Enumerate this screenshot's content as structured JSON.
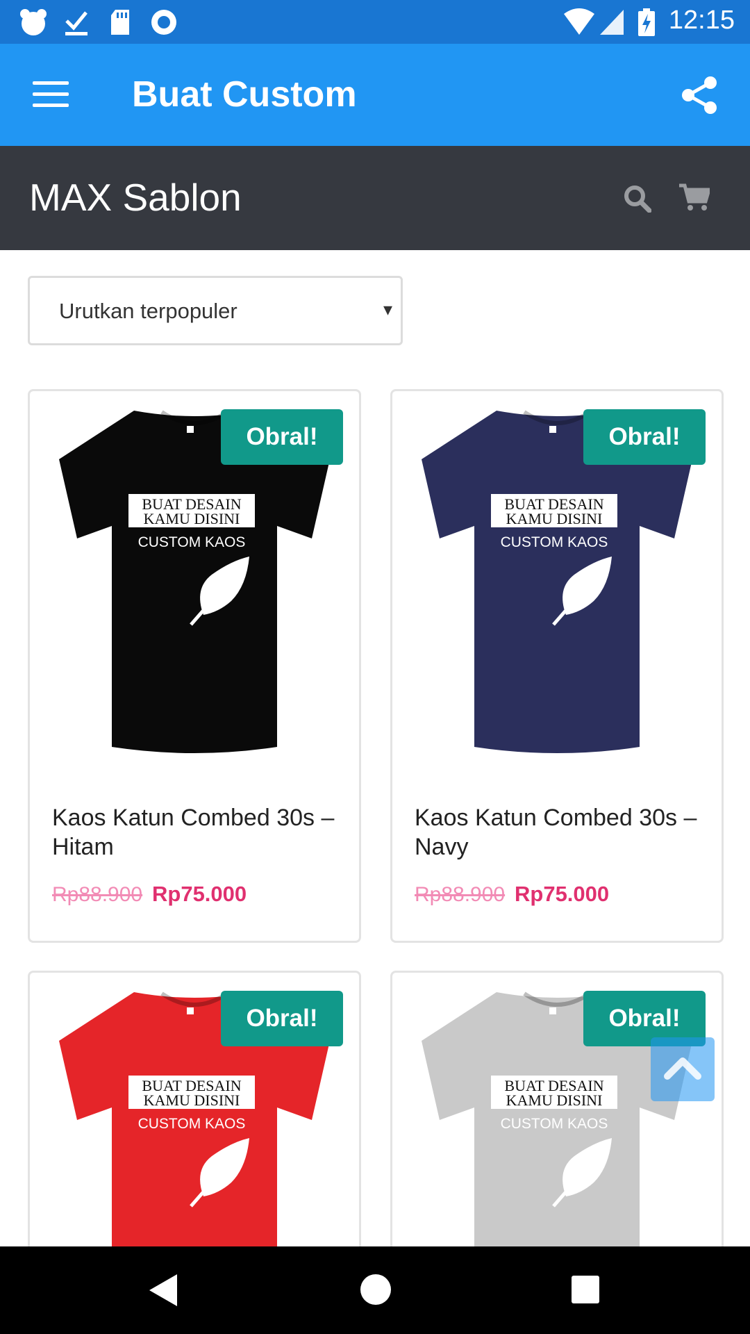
{
  "status_bar": {
    "time": "12:15",
    "icons": [
      "cloud-icon",
      "download-done-icon",
      "sd-card-icon",
      "record-icon",
      "wifi-icon",
      "signal-icon",
      "battery-charging-icon"
    ]
  },
  "app_bar": {
    "title": "Buat Custom",
    "icons": [
      "menu-icon",
      "share-icon"
    ]
  },
  "store_bar": {
    "title": "MAX Sablon",
    "icons": [
      "search-icon",
      "cart-icon"
    ]
  },
  "sort": {
    "selected": "Urutkan terpopuler",
    "arrow": "▾"
  },
  "products": [
    {
      "badge": "Obral!",
      "name": "Kaos Katun Combed 30s – Hitam",
      "price_old": "Rp88.900",
      "price_new": "Rp75.000",
      "shirt_color": "#0a0a0a",
      "print_line1": "BUAT DESAIN",
      "print_line2": "KAMU DISINI",
      "print_line3": "CUSTOM KAOS"
    },
    {
      "badge": "Obral!",
      "name": "Kaos Katun Combed 30s – Navy",
      "price_old": "Rp88.900",
      "price_new": "Rp75.000",
      "shirt_color": "#2b2f5c",
      "print_line1": "BUAT DESAIN",
      "print_line2": "KAMU DISINI",
      "print_line3": "CUSTOM KAOS"
    },
    {
      "badge": "Obral!",
      "shirt_color": "#e52529",
      "print_line1": "BUAT DESAIN",
      "print_line2": "KAMU DISINI",
      "print_line3": "CUSTOM KAOS"
    },
    {
      "badge": "Obral!",
      "shirt_color": "#c9c9c9",
      "print_line1": "BUAT DESAIN",
      "print_line2": "KAMU DISINI",
      "print_line3": "CUSTOM KAOS"
    }
  ],
  "colors": {
    "status_bar": "#1976d2",
    "app_bar": "#2196f3",
    "store_bar": "#363940",
    "badge": "#11998a",
    "price_new": "#e0306f",
    "price_old": "#f28bb5"
  }
}
